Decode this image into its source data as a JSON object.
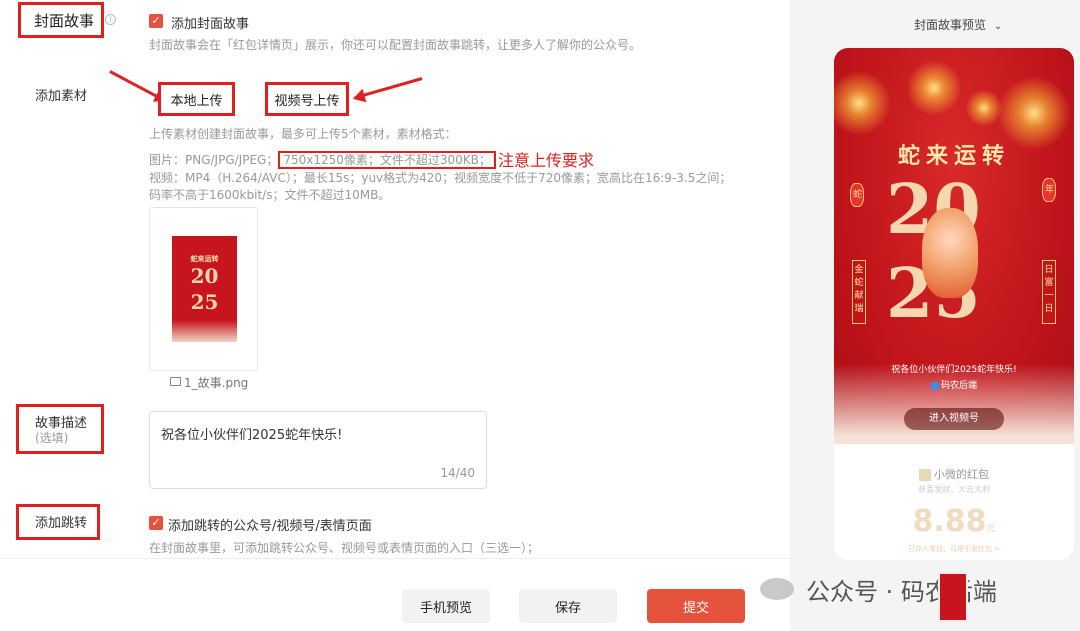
{
  "section": {
    "title": "封面故事",
    "checkbox_label": "添加封面故事",
    "desc": "封面故事会在「红包详情页」展示，你还可以配置封面故事跳转，让更多人了解你的公众号。"
  },
  "material": {
    "label": "添加素材",
    "local_upload": "本地上传",
    "channel_upload": "视频号上传",
    "hint_line1": "上传素材创建封面故事，最多可上传5个素材，素材格式：",
    "hint_image_prefix": "图片：PNG/JPG/JPEG；",
    "hint_image_highlight": "750x1250像素；文件不超过300KB；",
    "annotation": "注意上传要求",
    "hint_video1": "视频：MP4（H.264/AVC）；最长15s；yuv格式为420；视频宽度不低于720像素；宽高比在16:9-3.5之间；",
    "hint_video2": "码率不高于1600kbit/s；文件不超过10MB。",
    "file_name": "1_故事.png"
  },
  "story": {
    "label": "故事描述",
    "optional": "(选填)",
    "value": "祝各位小伙伴们2025蛇年快乐!",
    "counter": "14/40"
  },
  "jump": {
    "label": "添加跳转",
    "checkbox_label": "添加跳转的公众号/视频号/表情页面",
    "desc": "在封面故事里，可添加跳转公众号、视频号或表情页面的入口（三选一）；"
  },
  "footer": {
    "preview": "手机预览",
    "save": "保存",
    "submit": "提交"
  },
  "preview": {
    "header": "封面故事预览",
    "poster_title": "蛇来运转",
    "year_top": "20",
    "year_bottom": "25",
    "left_banner": "金蛇献瑞",
    "right_banner": "日富一日",
    "greeting": "祝各位小伙伴们2025蛇年快乐!",
    "account": "码农后端",
    "enter_button": "进入视频号",
    "lantern_left": "蛇",
    "lantern_right": "年",
    "redpacket_name": "小微的红包",
    "redpacket_sub": "恭喜发财，大吉大利",
    "amount": "8.88",
    "unit": "元",
    "bottom_note": "已存入零钱，可用于发红包 >"
  },
  "watermark": {
    "text": "公众号 · 码农后端"
  },
  "colors": {
    "accent": "#e5533c",
    "annotation_red": "#e02020",
    "poster_red": "#c1141b"
  }
}
